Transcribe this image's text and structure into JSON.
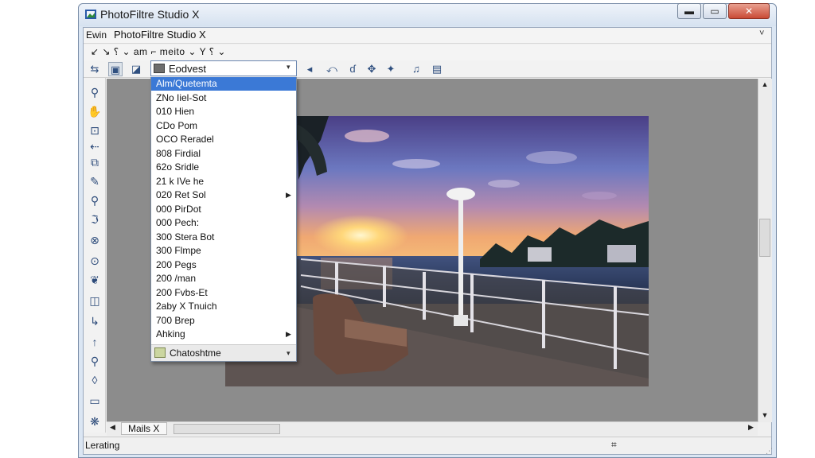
{
  "window": {
    "title": "PhotoFiltre Studio X",
    "buttons": {
      "minimize": "▬",
      "maximize": "▭",
      "close": "✕"
    }
  },
  "menubar": {
    "left_text": "Ewin",
    "title": "PhotoFiltre Studio X",
    "chevron": "˅"
  },
  "toolbar1": {
    "text": "↙ ↘  ⸮ ⌄ am ⌐ meito ⌄ Y ⸮ ⌄"
  },
  "filter_dropdown": {
    "selected_label": "Eodvest",
    "arrow": "▾",
    "items": [
      {
        "label": "Alm/Quetemta",
        "selected": true
      },
      {
        "label": "ZNo Iiel-Sot"
      },
      {
        "label": "010 Hien"
      },
      {
        "label": "CDo Pom"
      },
      {
        "label": "OCO Reradel"
      },
      {
        "label": "808 Firdial"
      },
      {
        "label": "62o Sridle"
      },
      {
        "label": "21 k IVe he"
      },
      {
        "label": "020 Ret Sol",
        "submenu": true
      },
      {
        "label": "000 PirDot"
      },
      {
        "label": "000 Pech:"
      },
      {
        "label": "300 Stera Bot"
      },
      {
        "label": "300 Flmpe"
      },
      {
        "label": "200 Pegs"
      },
      {
        "label": "200 /man"
      },
      {
        "label": "200 Fvbs-Et"
      },
      {
        "label": "2aby X Tnuich"
      },
      {
        "label": "700 Brep"
      },
      {
        "label": "Ahking",
        "submenu": true
      }
    ],
    "submenu_arrow": "▶",
    "bottom_label": "Chatoshtme",
    "bottom_arrow": "▾",
    "swatch_color": "#6d6d6d",
    "bottom_swatch_color": "#cbd6a0",
    "selected_color": "#3b79d6"
  },
  "toolbar2_icons": [
    "move-icon",
    "image-icon",
    "layers-icon",
    "undo-icon",
    "redo-icon",
    "brush-icon",
    "spray-icon",
    "effect-icon",
    "music-icon",
    "palette-icon"
  ],
  "tools": [
    "zoom-icon",
    "hand-icon",
    "selection-icon",
    "crop-icon",
    "transform-icon",
    "paint-icon",
    "eyedropper-icon",
    "lasso-icon",
    "wand-icon",
    "smudge-icon",
    "clone-icon",
    "gradient-icon",
    "arrow-icon",
    "shape-icon",
    "eraser-icon",
    "text-icon",
    "stamp-icon"
  ],
  "document_tab": {
    "label": "Mails X"
  },
  "status": {
    "text": "Lerating",
    "right": "⌗"
  },
  "colors": {
    "workspace": "#8c8c8c",
    "titlebar": "#dbe6f3",
    "close_button": "#c94a35"
  }
}
